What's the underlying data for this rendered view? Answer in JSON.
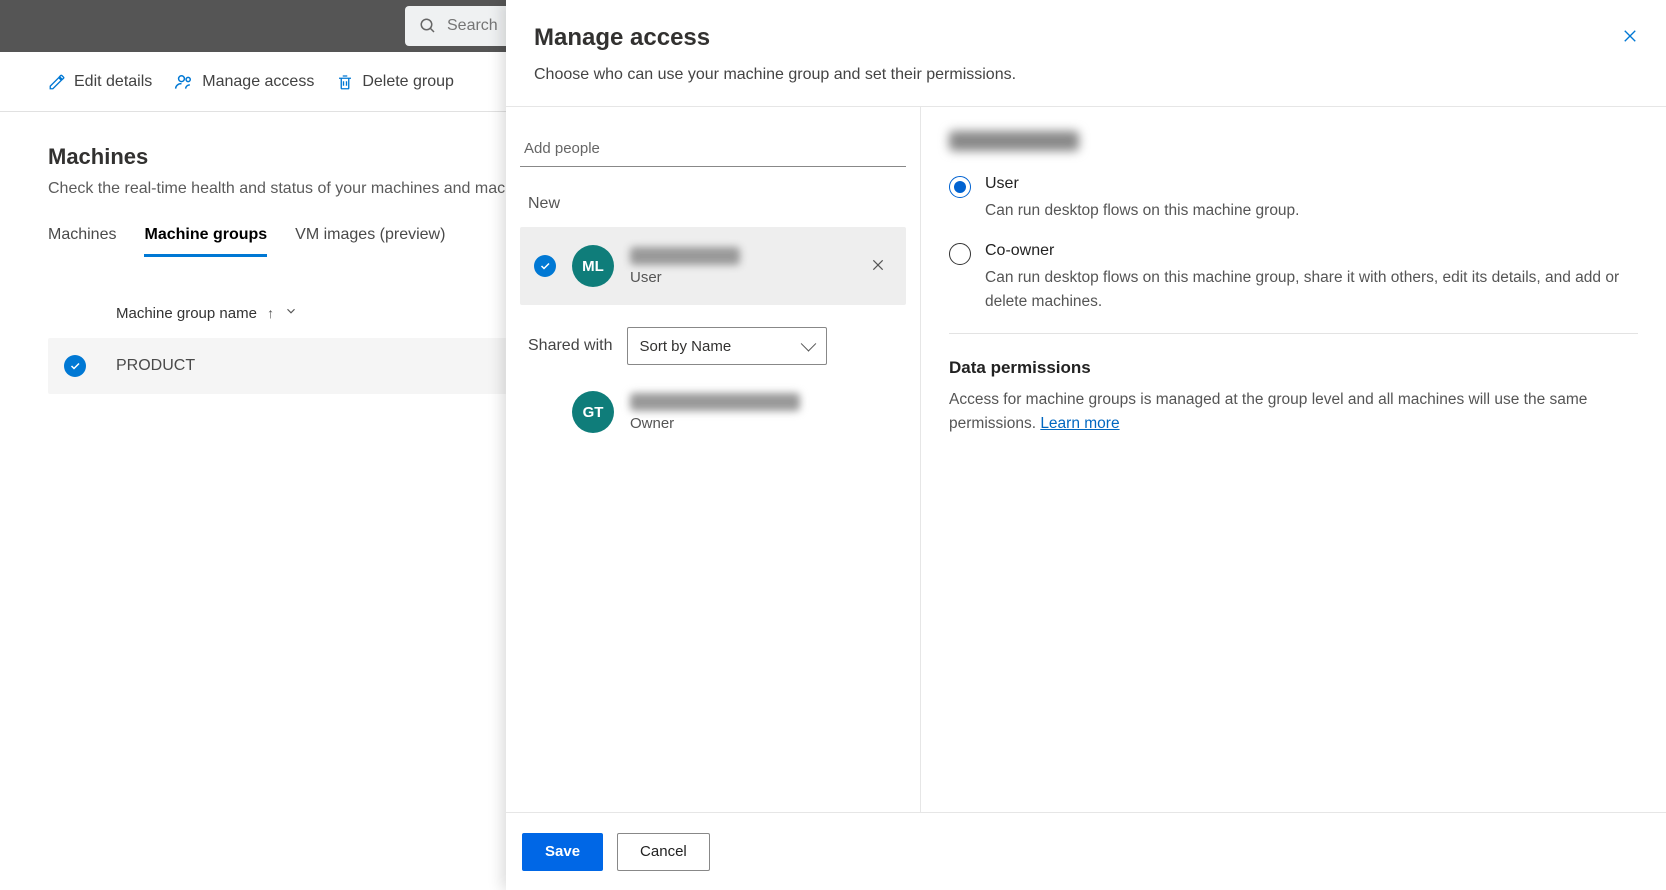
{
  "topbar": {
    "search_placeholder": "Search"
  },
  "commandbar": {
    "edit": "Edit details",
    "manage": "Manage access",
    "delete": "Delete group"
  },
  "page": {
    "title": "Machines",
    "subtitle": "Check the real-time health and status of your machines and machine groups."
  },
  "tabs": {
    "machines": "Machines",
    "groups": "Machine groups",
    "vm": "VM images (preview)"
  },
  "table": {
    "col_name": "Machine group name",
    "rows": [
      {
        "name": "PRODUCT"
      }
    ]
  },
  "panel": {
    "title": "Manage access",
    "subtitle": "Choose who can use your machine group and set their permissions.",
    "add_people_placeholder": "Add people",
    "new_label": "New",
    "shared_with_label": "Shared with",
    "sort_value": "Sort by Name",
    "people": {
      "new": {
        "initials": "ML",
        "role": "User"
      },
      "shared": {
        "initials": "GT",
        "role": "Owner"
      }
    },
    "roles": {
      "user": {
        "label": "User",
        "desc": "Can run desktop flows on this machine group."
      },
      "coowner": {
        "label": "Co-owner",
        "desc": "Can run desktop flows on this machine group, share it with others, edit its details, and add or delete machines."
      }
    },
    "data_permissions": {
      "title": "Data permissions",
      "text": "Access for machine groups is managed at the group level and all machines will use the same permissions. ",
      "learn_more": "Learn more"
    },
    "footer": {
      "save": "Save",
      "cancel": "Cancel"
    }
  }
}
